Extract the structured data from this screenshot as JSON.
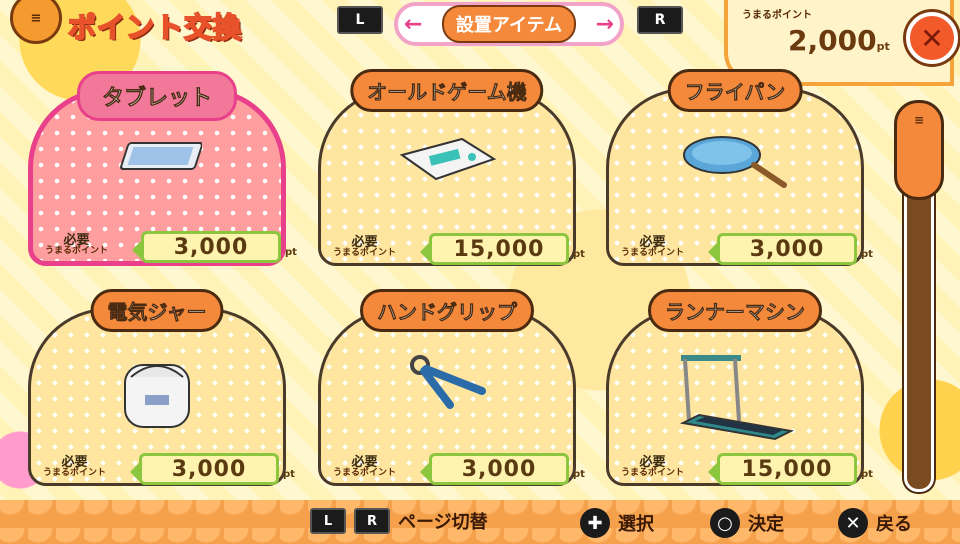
{
  "header": {
    "title": "ポイント交換",
    "l_button": "L",
    "r_button": "R",
    "category_prev_arrow": "←",
    "category_next_arrow": "→",
    "category_label": "設置アイテム",
    "points_label": "うまるポイント",
    "points_value": "2,000",
    "points_unit": "pt",
    "close_icon": "close-icon"
  },
  "items": [
    {
      "name": "タブレット",
      "cost_caption_top": "必要",
      "cost_caption_bottom": "うまるポイント",
      "cost": "3,000",
      "unit": "pt",
      "icon": "tablet-icon",
      "selected": true
    },
    {
      "name": "オールドゲーム機",
      "cost_caption_top": "必要",
      "cost_caption_bottom": "うまるポイント",
      "cost": "15,000",
      "unit": "pt",
      "icon": "game-console-icon",
      "selected": false
    },
    {
      "name": "フライパン",
      "cost_caption_top": "必要",
      "cost_caption_bottom": "うまるポイント",
      "cost": "3,000",
      "unit": "pt",
      "icon": "frying-pan-icon",
      "selected": false
    },
    {
      "name": "電気ジャー",
      "cost_caption_top": "必要",
      "cost_caption_bottom": "うまるポイント",
      "cost": "3,000",
      "unit": "pt",
      "icon": "rice-cooker-icon",
      "selected": false
    },
    {
      "name": "ハンドグリップ",
      "cost_caption_top": "必要",
      "cost_caption_bottom": "うまるポイント",
      "cost": "3,000",
      "unit": "pt",
      "icon": "hand-grip-icon",
      "selected": false
    },
    {
      "name": "ランナーマシン",
      "cost_caption_top": "必要",
      "cost_caption_bottom": "うまるポイント",
      "cost": "15,000",
      "unit": "pt",
      "icon": "treadmill-icon",
      "selected": false
    }
  ],
  "footer": {
    "l_button": "L",
    "r_button": "R",
    "page_switch_label": "ページ切替",
    "dpad_icon": "dpad-icon",
    "select_label": "選択",
    "circle_icon": "circle-button-icon",
    "confirm_label": "決定",
    "cross_icon": "cross-button-icon",
    "back_label": "戻る"
  },
  "colors": {
    "accent_orange": "#f5893b",
    "selected_pink": "#e8408a",
    "cost_green": "#8cc63f"
  }
}
